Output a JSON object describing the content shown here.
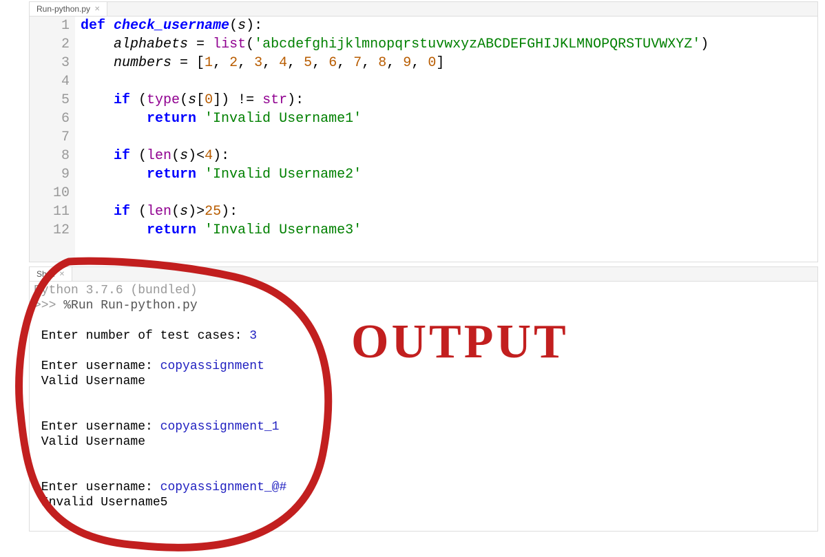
{
  "editor": {
    "tab_label": "Run-python.py",
    "line_numbers": [
      "1",
      "2",
      "3",
      "4",
      "5",
      "6",
      "7",
      "8",
      "9",
      "10",
      "11",
      "12"
    ],
    "code": {
      "l1_def": "def",
      "l1_name": "check_username",
      "l1_param": "s",
      "l2_var": "alphabets",
      "l2_list": "list",
      "l2_str": "'abcdefghijklmnopqrstuvwxyzABCDEFGHIJKLMNOPQRSTUVWXYZ'",
      "l3_var": "numbers",
      "l3_nums": [
        "1",
        "2",
        "3",
        "4",
        "5",
        "6",
        "7",
        "8",
        "9",
        "0"
      ],
      "l5_if": "if",
      "l5_type": "type",
      "l5_s": "s",
      "l5_zero": "0",
      "l5_str": "str",
      "l6_ret": "return",
      "l6_str": "'Invalid Username1'",
      "l8_if": "if",
      "l8_len": "len",
      "l8_s": "s",
      "l8_four": "4",
      "l9_ret": "return",
      "l9_str": "'Invalid Username2'",
      "l11_if": "if",
      "l11_len": "len",
      "l11_s": "s",
      "l11_tf": "25",
      "l12_ret": "return",
      "l12_str": "'Invalid Username3'"
    }
  },
  "shell": {
    "tab_label": "Shell",
    "banner": "Python 3.7.6 (bundled)",
    "prompt": ">>> ",
    "run_cmd": "%Run Run-python.py",
    "line1a": " Enter number of test cases: ",
    "line1b": "3",
    "line2a": " Enter username: ",
    "line2b": "copyassignment",
    "line3": " Valid Username",
    "line4a": " Enter username: ",
    "line4b": "copyassignment_1",
    "line5": " Valid Username",
    "line6a": " Enter username: ",
    "line6b": "copyassignment_@#",
    "line7": " Invalid Username5"
  },
  "annotation": {
    "label": "OUTPUT"
  }
}
